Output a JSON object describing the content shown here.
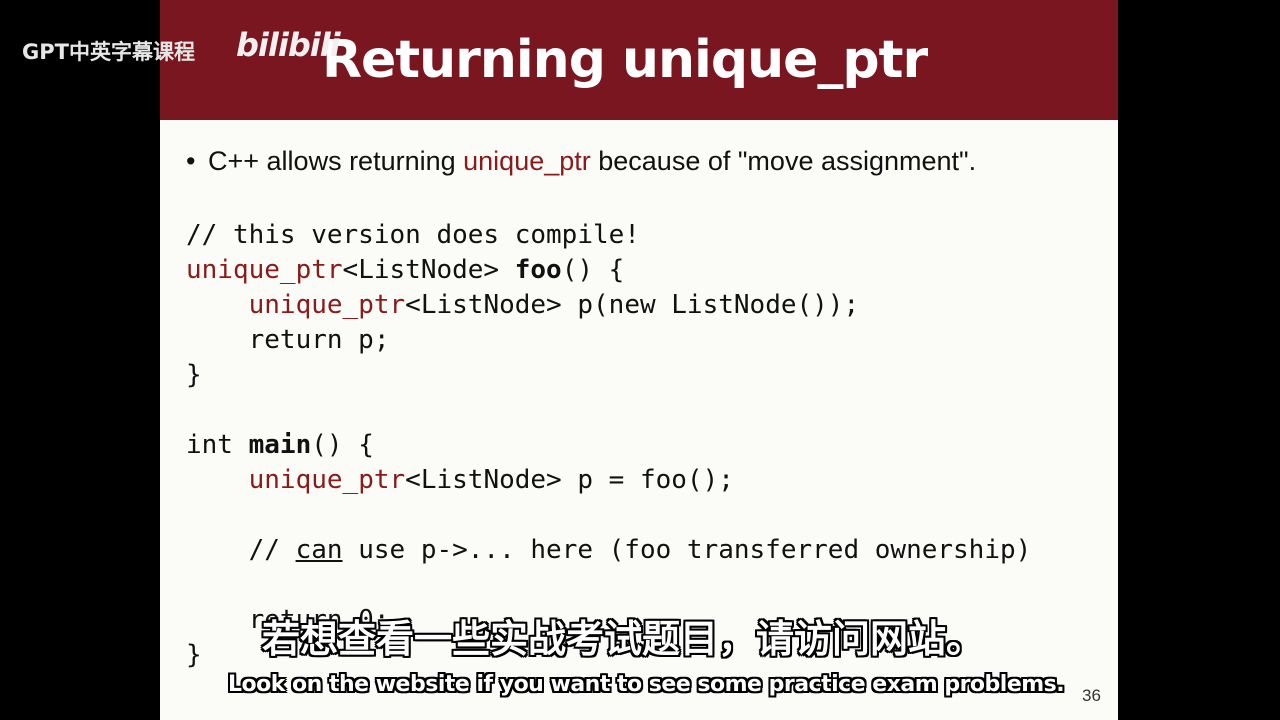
{
  "watermark": {
    "text": "GPT中英字幕课程",
    "logo": "bilibili"
  },
  "slide": {
    "title": "Returning unique_ptr",
    "bullet": {
      "pre": "C++ allows returning ",
      "keyword": "unique_ptr",
      "post": " because of \"move assignment\"."
    },
    "code": [
      "// this version does compile!",
      "unique_ptr<ListNode> foo() {",
      "    unique_ptr<ListNode> p(new ListNode());",
      "    return p;",
      "}",
      "",
      "int main() {",
      "    unique_ptr<ListNode> p = foo();",
      "",
      "    // can use p->... here (foo transferred ownership)",
      "",
      "    return 0;",
      "}"
    ],
    "page_number": "36"
  },
  "subtitles": {
    "chinese": "若想查看一些实战考试题目，请访问网站。",
    "english": "Look on the website if you want to see some practice exam problems."
  },
  "colors": {
    "title_bar": "#7a1620",
    "slide_bg": "#fbfbf8",
    "type_keyword": "#8b1a1a"
  }
}
